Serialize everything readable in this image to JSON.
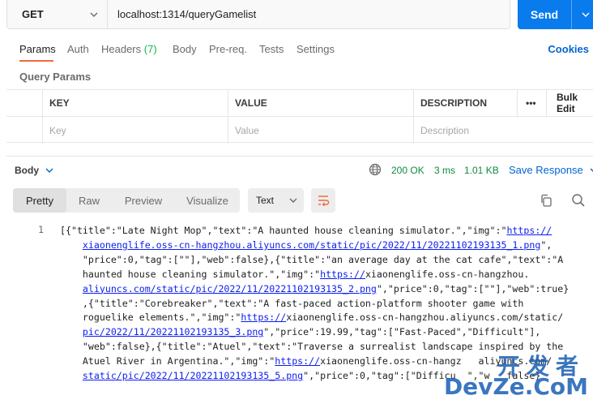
{
  "request": {
    "method": "GET",
    "url": "localhost:1314/queryGamelist",
    "send_label": "Send"
  },
  "tabs": [
    {
      "label": "Params"
    },
    {
      "label": "Auth"
    },
    {
      "label": "Headers",
      "count": "(7)"
    },
    {
      "label": "Body"
    },
    {
      "label": "Pre-req."
    },
    {
      "label": "Tests"
    },
    {
      "label": "Settings"
    }
  ],
  "cookies_label": "Cookies",
  "query_params": {
    "title": "Query Params",
    "columns": [
      "KEY",
      "VALUE",
      "DESCRIPTION",
      "Bulk Edit"
    ],
    "more_label": "•••",
    "placeholders": {
      "key": "Key",
      "value": "Value",
      "description": "Description"
    }
  },
  "response": {
    "body_label": "Body",
    "status": "200 OK",
    "time": "3 ms",
    "size": "1.01 KB",
    "save_label": "Save Response",
    "views": [
      "Pretty",
      "Raw",
      "Preview",
      "Visualize"
    ],
    "format": "Text",
    "line_number": "1",
    "code_lines": [
      "[{\"title\":\"Late Night Mop\",\"text\":\"A haunted house cleaning simulator.\",\"img\":\"https://",
      "    xiaonenglife.oss-cn-hangzhou.aliyuncs.com/static/pic/2022/11/20221102193135_1.png\",",
      "    \"price\":0,\"tag\":[\"\"],\"web\":false},{\"title\":\"an average day at the cat cafe\",\"text\":\"A",
      "    haunted house cleaning simulator.\",\"img\":\"https://xiaonenglife.oss-cn-hangzhou.",
      "    aliyuncs.com/static/pic/2022/11/20221102193135_2.png\",\"price\":0,\"tag\":[\"\"],\"web\":true}",
      "    ,{\"title\":\"Corebreaker\",\"text\":\"A fast-paced action-platform shooter game with",
      "    roguelike elements.\",\"img\":\"https://xiaonenglife.oss-cn-hangzhou.aliyuncs.com/static/",
      "    pic/2022/11/20221102193135_3.png\",\"price\":19.99,\"tag\":[\"Fast-Paced\",\"Difficult\"],",
      "    \"web\":false},{\"title\":\"Atuel\",\"text\":\"Traverse a surrealist landscape inspired by the",
      "    Atuel River in Argentina.\",\"img\":\"https://xiaonenglife.oss-cn-hangz   aliyuncs.com/",
      "    static/pic/2022/11/20221102193135_5.png\",\"price\":0,\"tag\":[\"Difficu  \",\"w   false}"
    ]
  },
  "watermark": {
    "top": "开发者",
    "bottom": "DevZe.CoM"
  },
  "colors": {
    "accent": "#f26b3a",
    "send": "#097bed",
    "link": "#0265d2",
    "success": "#0d8c3f"
  }
}
